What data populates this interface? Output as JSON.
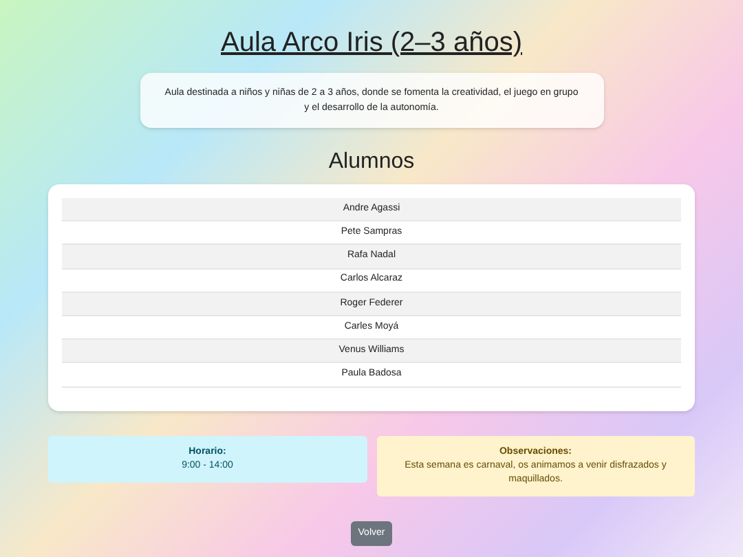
{
  "title": "Aula Arco Iris (2–3 años)",
  "description": "Aula destinada a niños y niñas de 2 a 3 años, donde se fomenta la creatividad, el juego en grupo y el desarrollo de la autonomía.",
  "students_heading": "Alumnos",
  "students": [
    "Andre Agassi",
    "Pete Sampras",
    "Rafa Nadal",
    "Carlos Alcaraz",
    "Roger Federer",
    "Carles Moyá",
    "Venus Williams",
    "Paula Badosa"
  ],
  "info_boxes": [
    {
      "kind": "schedule",
      "label": "Horario:",
      "text": "9:00 - 14:00"
    },
    {
      "kind": "notes",
      "label": "Observaciones:",
      "text": "Esta semana es carnaval, os animamos a venir disfrazados y maquillados."
    }
  ],
  "back_button": "Volver"
}
